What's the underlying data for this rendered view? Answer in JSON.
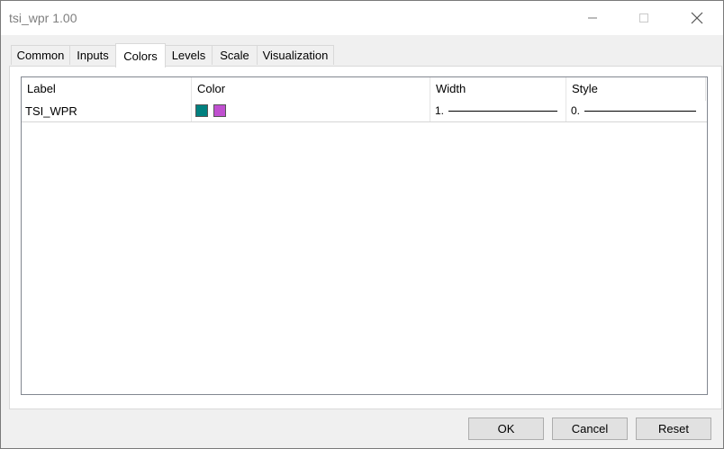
{
  "window": {
    "title": "tsi_wpr 1.00"
  },
  "tabs": [
    {
      "label": "Common"
    },
    {
      "label": "Inputs"
    },
    {
      "label": "Colors",
      "active": true
    },
    {
      "label": "Levels"
    },
    {
      "label": "Scale"
    },
    {
      "label": "Visualization"
    }
  ],
  "table": {
    "columns": [
      "Label",
      "Color",
      "Width",
      "Style"
    ],
    "rows": [
      {
        "label": "TSI_WPR",
        "colors": [
          "#00807f",
          "#c050d0"
        ],
        "width": "1.",
        "style": "0."
      }
    ]
  },
  "buttons": {
    "ok": "OK",
    "cancel": "Cancel",
    "reset": "Reset"
  },
  "icons": {
    "minimize": "minimize-icon",
    "maximize": "maximize-icon",
    "close": "close-icon"
  }
}
